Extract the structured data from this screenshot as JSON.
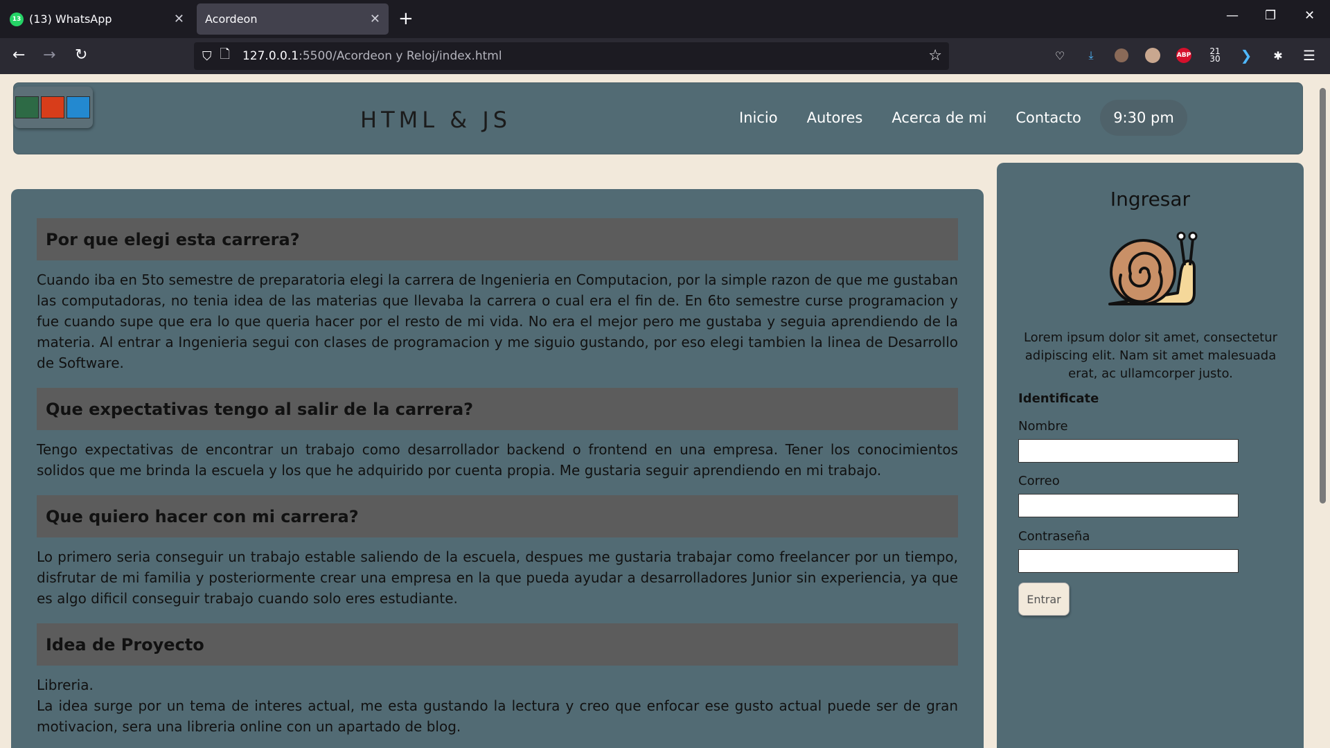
{
  "browser": {
    "tabs": [
      {
        "label": "(13) WhatsApp",
        "badge": "13",
        "active": false
      },
      {
        "label": "Acordeon",
        "active": true
      }
    ],
    "url_host": "127.0.0.1",
    "url_path": ":5500/Acordeon y Reloj/index.html",
    "clock_ext": "21\n30",
    "abp_label": "ABP"
  },
  "header": {
    "title": "HTML & JS",
    "swatch_colors": [
      "#2d6a45",
      "#d83d1a",
      "#2389d0"
    ],
    "menu": [
      "Inicio",
      "Autores",
      "Acerca de mi",
      "Contacto"
    ],
    "clock": "9:30 pm"
  },
  "accordion": [
    {
      "title": "Por que elegi esta carrera?",
      "body": "Cuando iba en 5to semestre de preparatoria elegi la carrera de Ingenieria en Computacion, por la simple razon de que me gustaban las computadoras, no tenia idea de las materias que llevaba la carrera o cual era el fin de. En 6to semestre curse programacion y fue cuando supe que era lo que queria hacer por el resto de mi vida. No era el mejor pero me gustaba y seguia aprendiendo de la materia. Al entrar a Ingenieria segui con clases de programacion y me siguio gustando, por eso elegi tambien la linea de Desarrollo de Software."
    },
    {
      "title": "Que expectativas tengo al salir de la carrera?",
      "body": "Tengo expectativas de encontrar un trabajo como desarrollador backend o frontend en una empresa. Tener los conocimientos solidos que me brinda la escuela y los que he adquirido por cuenta propia. Me gustaria seguir aprendiendo en mi trabajo."
    },
    {
      "title": "Que quiero hacer con mi carrera?",
      "body": "Lo primero seria conseguir un trabajo estable saliendo de la escuela, despues me gustaria trabajar como freelancer por un tiempo, disfrutar de mi familia y posteriormente crear una empresa en la que pueda ayudar a desarrolladores Junior sin experiencia, ya que es algo dificil conseguir trabajo cuando solo eres estudiante."
    },
    {
      "title": "Idea de Proyecto",
      "body_line1": "Libreria.",
      "body": "La idea surge por un tema de interes actual, me esta gustando la lectura y creo que enfocar ese gusto actual puede ser de gran motivacion, sera una libreria online con un apartado de blog."
    }
  ],
  "login": {
    "title": "Ingresar",
    "text": "Lorem ipsum dolor sit amet, consectetur adipiscing elit. Nam sit amet malesuada erat, ac ullamcorper justo.",
    "subtitle": "Identificate",
    "fields": [
      {
        "label": "Nombre",
        "value": ""
      },
      {
        "label": "Correo",
        "value": ""
      },
      {
        "label": "Contraseña",
        "value": ""
      }
    ],
    "button": "Entrar"
  }
}
